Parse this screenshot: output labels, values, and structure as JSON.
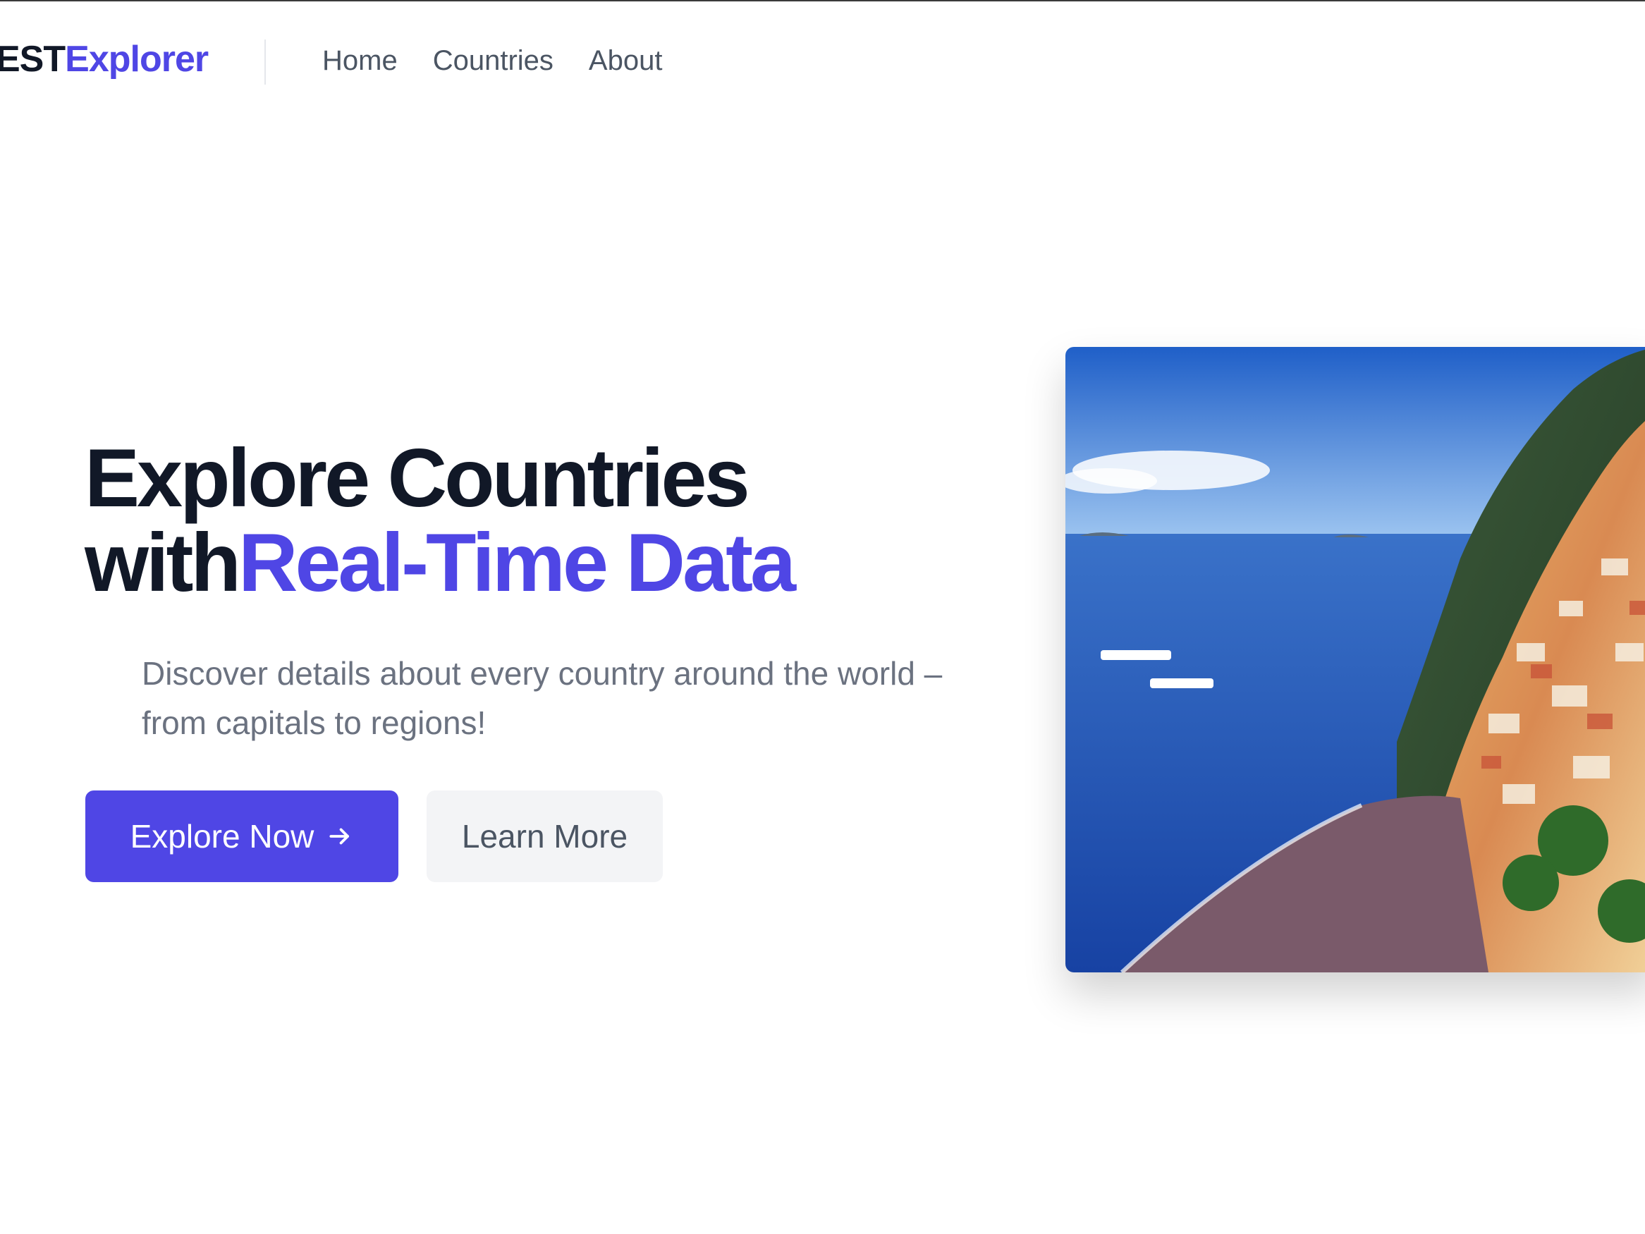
{
  "brand": {
    "logo_part1": "EST",
    "logo_part2": "Explorer",
    "accent_color": "#4f46e5"
  },
  "nav": {
    "items": [
      {
        "label": "Home"
      },
      {
        "label": "Countries"
      },
      {
        "label": "About"
      }
    ]
  },
  "hero": {
    "title_line1": "Explore Countries",
    "title_line2_plain": "with",
    "title_line2_accent": "Real-Time Data",
    "subtitle": "Discover details about every country around the world – from capitals to regions!",
    "primary_button": {
      "label": "Explore Now",
      "icon": "arrow-right-icon"
    },
    "secondary_button": {
      "label": "Learn More"
    },
    "image": {
      "subject": "coastal-village-photo"
    }
  }
}
